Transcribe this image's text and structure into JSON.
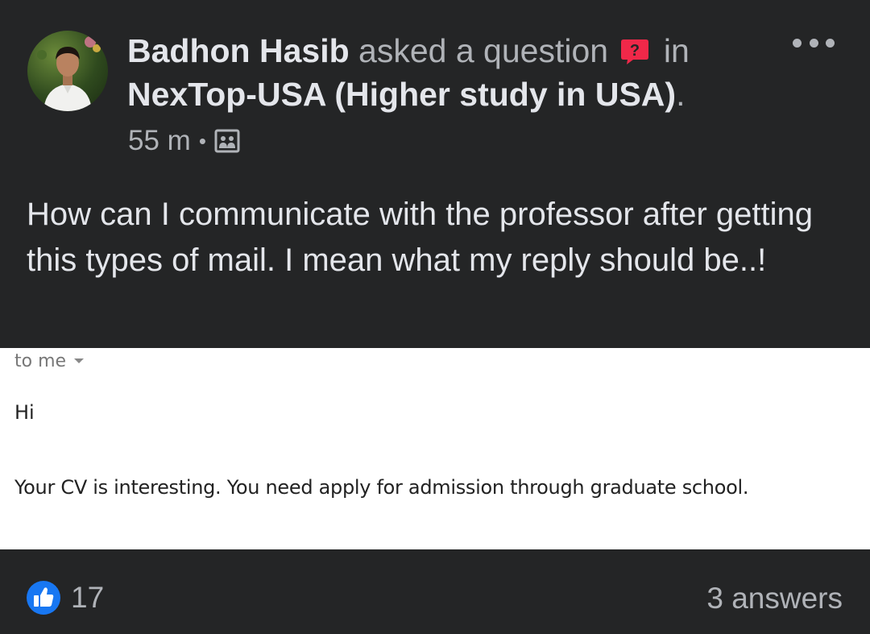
{
  "post": {
    "author": "Badhon Hasib",
    "action": "asked a question",
    "preposition": "in",
    "group": "NexTop-USA (Higher study in USA)",
    "period": ".",
    "time": "55 m",
    "separator": "•",
    "body": "How can I communicate with the professor after getting this types of mail. I mean what my reply should be..!"
  },
  "email": {
    "recipient": "to me",
    "greeting": "Hi",
    "message": "Your CV is interesting. You need apply for admission through graduate school."
  },
  "footer": {
    "like_count": "17",
    "answers": "3 answers"
  },
  "icons": {
    "question": "question-icon",
    "group": "group-icon",
    "like": "like-icon",
    "more": "more-options-icon"
  },
  "colors": {
    "background": "#242526",
    "primary_text": "#e4e6eb",
    "secondary_text": "#b0b3b8",
    "question_badge": "#f02849",
    "like_blue": "#1877f2"
  }
}
